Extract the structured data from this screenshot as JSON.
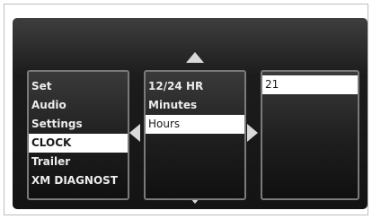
{
  "menu": {
    "items": [
      {
        "label": "Set"
      },
      {
        "label": "Audio"
      },
      {
        "label": "Settings"
      },
      {
        "label": "CLOCK",
        "selected": true
      },
      {
        "label": "Trailer"
      },
      {
        "label": "XM DIAGNOST"
      }
    ]
  },
  "submenu": {
    "items": [
      {
        "label": "12/24 HR"
      },
      {
        "label": "Minutes"
      },
      {
        "label": "Hours",
        "selected": true
      }
    ]
  },
  "value": {
    "current": "21"
  },
  "icons": {
    "up": "arrow-up-icon",
    "down": "arrow-down-icon",
    "left": "arrow-left-icon",
    "right": "arrow-right-icon"
  },
  "colors": {
    "selection_bg": "#ffffff",
    "text": "#ececec",
    "panel_border": "#7a7a7a"
  }
}
